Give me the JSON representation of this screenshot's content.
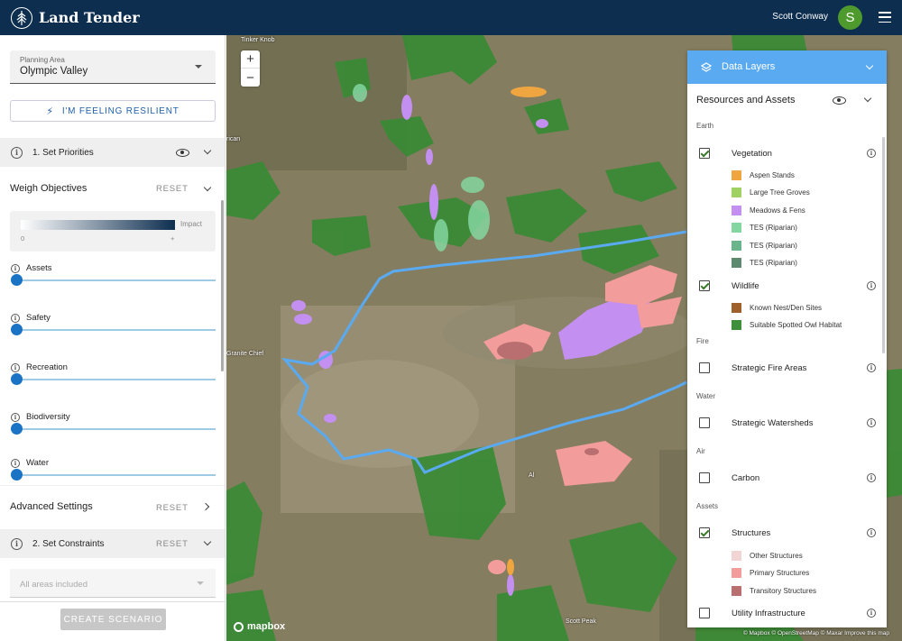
{
  "app": {
    "name": "Land Tender",
    "user": "Scott Conway",
    "avatar_initial": "S"
  },
  "left_panel": {
    "planning_area": {
      "label": "Planning Area",
      "value": "Olympic Valley"
    },
    "resilient_button": "I'M FEELING RESILIENT",
    "step1": {
      "title": "1. Set Priorities"
    },
    "weigh_objectives": {
      "title": "Weigh Objectives",
      "reset": "RESET"
    },
    "impact_legend": {
      "label": "Impact",
      "min": "0",
      "max": "+"
    },
    "objectives": [
      {
        "label": "Assets",
        "value": 0
      },
      {
        "label": "Safety",
        "value": 0
      },
      {
        "label": "Recreation",
        "value": 0
      },
      {
        "label": "Biodiversity",
        "value": 0
      },
      {
        "label": "Water",
        "value": 0
      }
    ],
    "advanced_settings": {
      "title": "Advanced Settings",
      "reset": "RESET"
    },
    "step2": {
      "title": "2. Set Constraints",
      "reset": "RESET"
    },
    "constraints_dropdown": {
      "placeholder": "All areas included"
    },
    "create_button": "CREATE SCENARIO"
  },
  "map": {
    "place_labels": [
      "Tinker Knob",
      "Granite Chief",
      "Scott Peak"
    ],
    "partial_labels": [
      "rican",
      "Al"
    ],
    "attribution": "© Mapbox © OpenStreetMap © Maxar Improve this map",
    "logo": "mapbox"
  },
  "layers_panel": {
    "title": "Data Layers",
    "section": "Resources and Assets",
    "categories": {
      "earth": "Earth",
      "fire": "Fire",
      "water": "Water",
      "air": "Air",
      "assets": "Assets"
    },
    "layers": {
      "vegetation": {
        "name": "Vegetation",
        "checked": true
      },
      "wildlife": {
        "name": "Wildlife",
        "checked": true
      },
      "strategic_fire": {
        "name": "Strategic Fire Areas",
        "checked": false
      },
      "strategic_watersheds": {
        "name": "Strategic Watersheds",
        "checked": false
      },
      "carbon": {
        "name": "Carbon",
        "checked": false
      },
      "structures": {
        "name": "Structures",
        "checked": true
      },
      "utility": {
        "name": "Utility Infrastructure",
        "checked": false
      }
    },
    "vegetation_legend": [
      {
        "label": "Aspen Stands",
        "color": "#f0a640"
      },
      {
        "label": "Large Tree Groves",
        "color": "#9fd163"
      },
      {
        "label": "Meadows & Fens",
        "color": "#c38ff0"
      },
      {
        "label": "TES (Riparian)",
        "color": "#84d6a0"
      },
      {
        "label": "TES (Riparian)",
        "color": "#6bb58d"
      },
      {
        "label": "TES (Riparian)",
        "color": "#5d8a6f"
      }
    ],
    "wildlife_legend": [
      {
        "label": "Known Nest/Den Sites",
        "color": "#a0602b"
      },
      {
        "label": "Suitable Spotted Owl Habitat",
        "color": "#3f8f3a"
      }
    ],
    "structures_legend": [
      {
        "label": "Other Structures",
        "color": "#f1d4d4"
      },
      {
        "label": "Primary Structures",
        "color": "#f29c9c"
      },
      {
        "label": "Transitory Structures",
        "color": "#b96f6f"
      }
    ]
  }
}
